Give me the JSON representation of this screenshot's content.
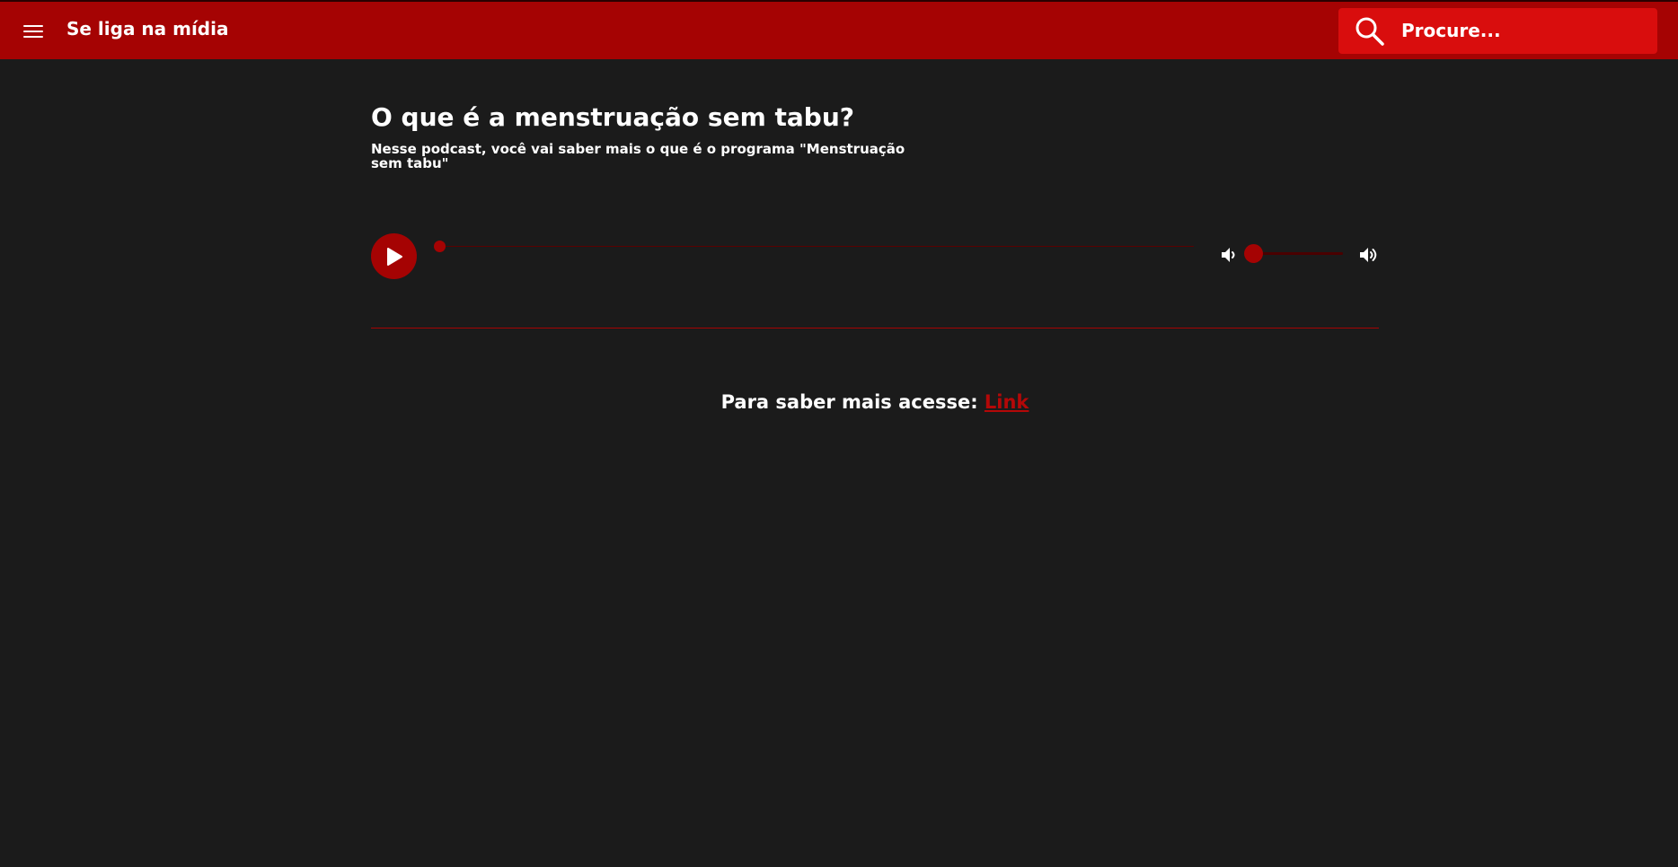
{
  "header": {
    "brand": "Se liga na mídia",
    "menu_icon": "hamburger-menu-icon",
    "search": {
      "icon": "search-icon",
      "placeholder": "Procure..."
    }
  },
  "main": {
    "title": "O que é a menstruação sem tabu?",
    "subtitle": "Nesse podcast, você vai saber mais o que é o programa \"Menstruação sem tabu\"",
    "player": {
      "play_icon": "play-icon",
      "progress_fraction": 0.0,
      "volume_fraction": 0.0,
      "volume_low_icon": "volume-low-icon",
      "volume_high_icon": "volume-high-icon"
    },
    "more": {
      "text": "Para saber mais acesse:",
      "link_label": "Link"
    }
  },
  "colors": {
    "header_bg": "#a50303",
    "search_bg": "#d90d0d",
    "page_bg": "#1b1b1b",
    "accent": "#a50303",
    "link": "#b40808"
  }
}
